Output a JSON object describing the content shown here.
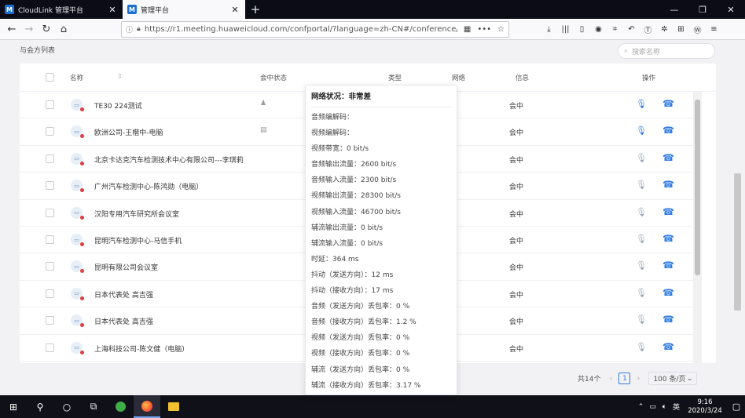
{
  "browser": {
    "tabs": [
      {
        "favicon": "M",
        "title": "CloudLink 管理平台",
        "active": false
      },
      {
        "favicon": "M",
        "title": "管理平台",
        "active": true
      }
    ],
    "new_tab": "+",
    "url": "https://r1.meeting.huaweicloud.com/confportal/?language=zh-CN#/conference/",
    "url_more": "•••"
  },
  "page": {
    "section_title": "与会方列表",
    "search_placeholder": "搜索名称",
    "columns": {
      "name": "名称",
      "status": "会中状态",
      "type": "类型",
      "network": "网络",
      "info": "信息",
      "actions": "操作"
    },
    "rows": [
      {
        "name": "TE30 224测试",
        "info": "会中",
        "mic_muted": false,
        "status_icon": "person"
      },
      {
        "name": "欧洲公司-王楷中-电脑",
        "info": "会中",
        "mic_muted": false,
        "status_icon": "calendar"
      },
      {
        "name": "北京卡达克汽车检测技术中心有限公司---李琪莉",
        "info": "会中",
        "mic_muted": true
      },
      {
        "name": "广州汽车检测中心-陈鸿勋（电脑）",
        "info": "会中",
        "mic_muted": true
      },
      {
        "name": "汉阳专用汽车研究所会议室",
        "info": "会中",
        "mic_muted": true
      },
      {
        "name": "昆明汽车检测中心-马信手机",
        "info": "会中",
        "mic_muted": true
      },
      {
        "name": "昆明有限公司会议室",
        "info": "会中",
        "mic_muted": true
      },
      {
        "name": "日本代表处 高吉强",
        "info": "会中",
        "mic_muted": true
      },
      {
        "name": "日本代表处 高吉强",
        "info": "会中",
        "mic_muted": true
      },
      {
        "name": "上海科技公司-陈文健（电脑）",
        "info": "会中",
        "mic_muted": true
      }
    ],
    "pagination": {
      "total": "共14个",
      "current": "1",
      "page_size": "100 条/页"
    }
  },
  "tooltip": {
    "title": "网络状况：非常差",
    "items": [
      "音频编解码：",
      "视频编解码：",
      "视频带宽：0 bit/s",
      "音频输出流量：2600 bit/s",
      "音频输入流量：2300 bit/s",
      "视频输出流量：28300 bit/s",
      "视频输入流量：46700 bit/s",
      "辅流输出流量：0 bit/s",
      "辅流输入流量：0 bit/s",
      "时延：364 ms",
      "抖动（发送方向）：12 ms",
      "抖动（接收方向）：17 ms",
      "音频（发送方向）丢包率：0 %",
      "音频（接收方向）丢包率：1.2 %",
      "视频（发送方向）丢包率：0 %",
      "视频（接收方向）丢包率：0 %",
      "辅流（发送方向）丢包率：0 %",
      "辅流（接收方向）丢包率：3.17 %"
    ]
  },
  "taskbar": {
    "ime": "英",
    "time": "9:16",
    "date": "2020/3/24"
  }
}
